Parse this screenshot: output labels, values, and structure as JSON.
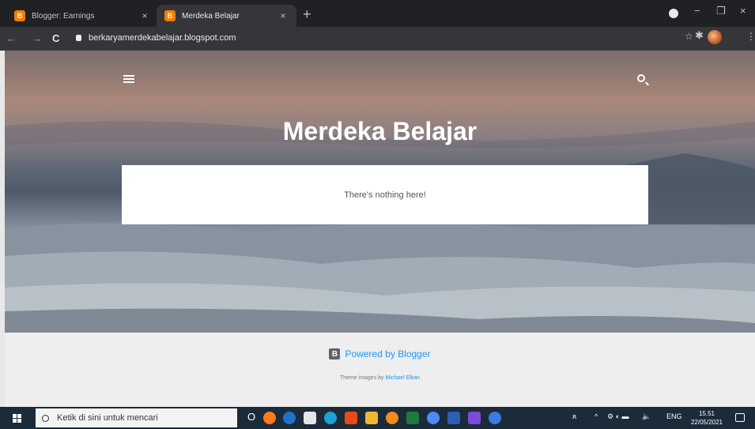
{
  "browser": {
    "tabs": [
      {
        "title": "Blogger: Earnings",
        "favicon": "B",
        "active": false
      },
      {
        "title": "Merdeka Belajar",
        "favicon": "B",
        "active": true
      }
    ],
    "new_tab": "+",
    "close_glyph": "×",
    "url": "berkaryamerdekabelajar.blogspot.com",
    "nav": {
      "back": "←",
      "forward": "→",
      "reload": "C"
    },
    "window_controls": {
      "minimize": "−",
      "maximize": "❐",
      "close": "×"
    },
    "toolbar_icons": [
      "star-icon",
      "extensions-icon",
      "profile-avatar",
      "menu-icon"
    ],
    "star": "☆",
    "kebab": "⋮"
  },
  "blog": {
    "title": "Merdeka Belajar",
    "empty_message": "There's nothing here!",
    "powered_by": "Powered by Blogger",
    "blogger_logo": "B",
    "credit_prefix": "Theme images by ",
    "credit_author": "Michael Elkan"
  },
  "taskbar": {
    "search_placeholder": "Ketik di sini untuk mencari",
    "cortana_glyph": "O",
    "tray": {
      "people": "ጸ",
      "chevron": "^",
      "language": "ENG",
      "volume": "🔈"
    },
    "time": "15.51",
    "date": "22/05/2021"
  },
  "colors": {
    "link": "#2196f3",
    "tab_bar": "#202124",
    "toolbar": "#35363a",
    "taskbar": "#1c2b3a",
    "blogger_orange": "#f57d00"
  }
}
